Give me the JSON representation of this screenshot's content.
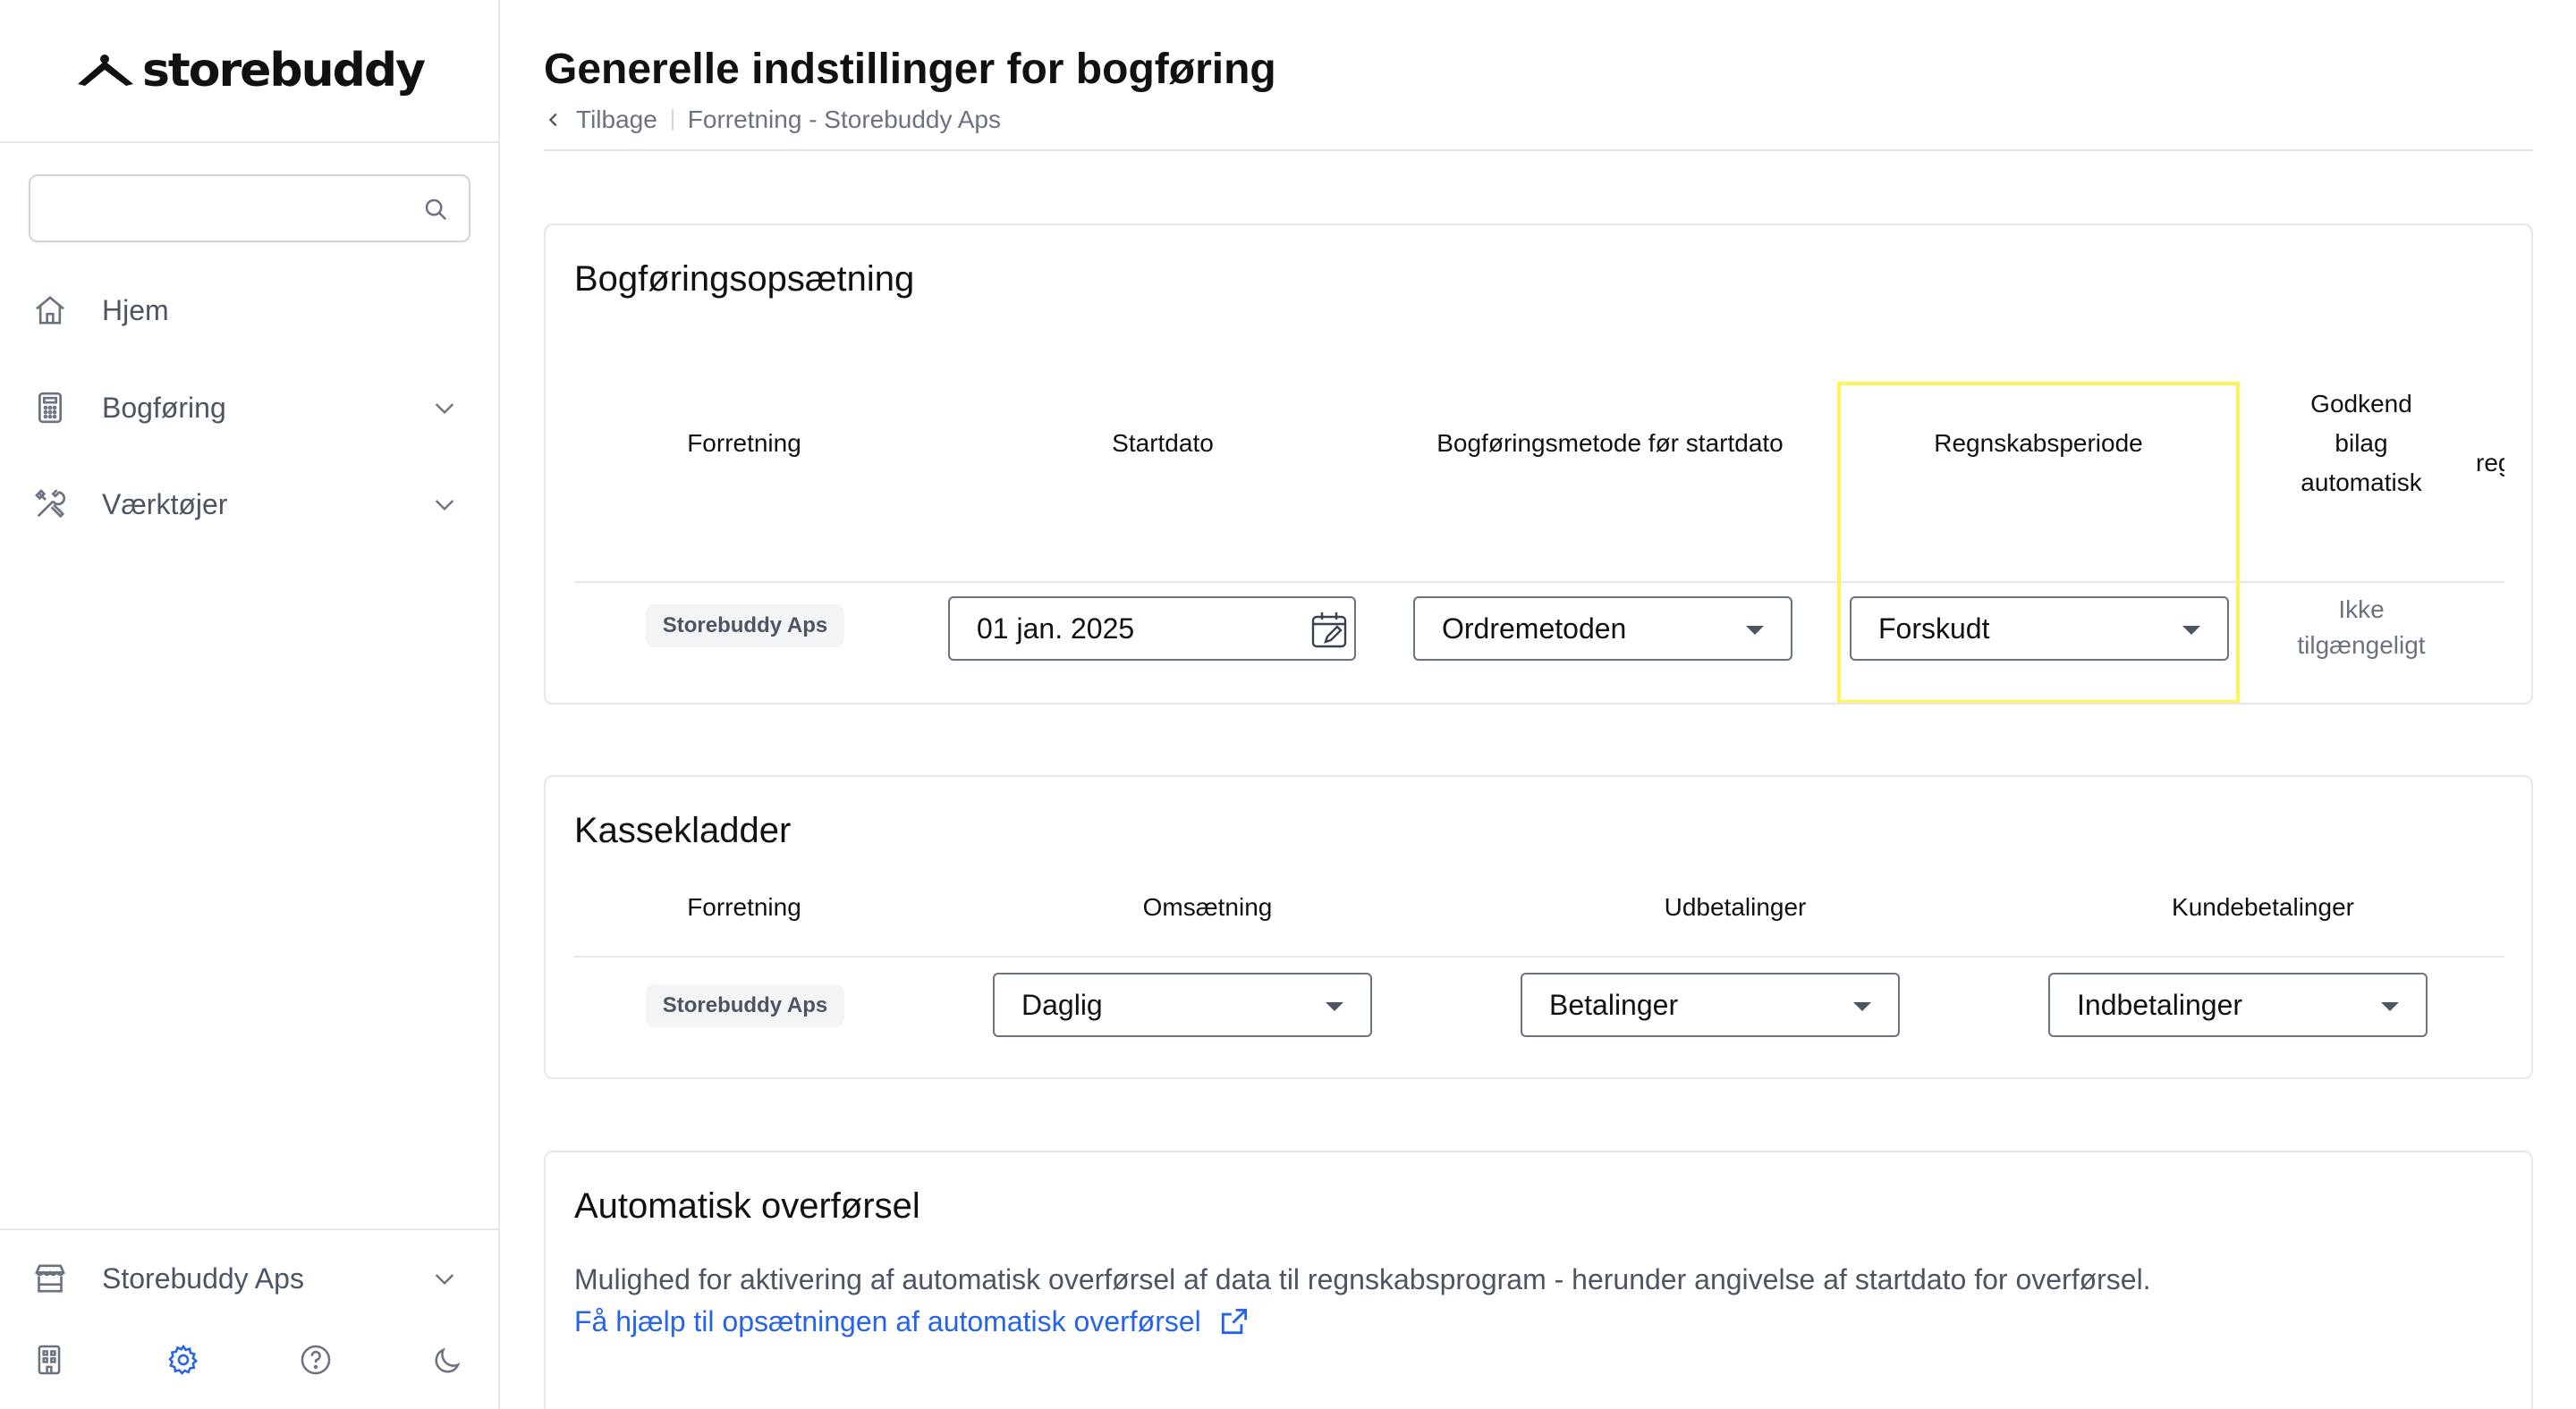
{
  "brand": {
    "logo_text": "storebuddy"
  },
  "sidebar": {
    "search": {
      "placeholder": ""
    },
    "items": [
      {
        "label": "Hjem",
        "icon": "home-icon"
      },
      {
        "label": "Bogføring",
        "icon": "calculator-icon",
        "expandable": true
      },
      {
        "label": "Værktøjer",
        "icon": "tools-icon",
        "expandable": true
      }
    ],
    "business_switcher": {
      "label": "Storebuddy Aps",
      "icon": "store-icon"
    },
    "footer_icons": [
      "building-icon",
      "gear-icon",
      "help-icon",
      "moon-icon"
    ]
  },
  "header": {
    "title": "Generelle indstillinger for bogføring",
    "back_label": "Tilbage",
    "breadcrumb_current": "Forretning - Storebuddy Aps"
  },
  "setup_card": {
    "title": "Bogføringsopsætning",
    "headers": {
      "business": "Forretning",
      "start_date": "Startdato",
      "method": "Bogføringsmetode før startdato",
      "period": "Regnskabsperiode",
      "approve_line1": "Godkend",
      "approve_line2": "bilag",
      "approve_line3": "automatisk",
      "cut_off": "reg"
    },
    "row": {
      "business": "Storebuddy Aps",
      "start_date": "01 jan. 2025",
      "method": "Ordremetoden",
      "period": "Forskudt",
      "approve_line1": "Ikke",
      "approve_line2": "tilgængeligt"
    }
  },
  "cash_card": {
    "title": "Kassekladder",
    "headers": {
      "business": "Forretning",
      "revenue": "Omsætning",
      "payouts": "Udbetalinger",
      "customer_payments": "Kundebetalinger"
    },
    "row": {
      "business": "Storebuddy Aps",
      "revenue": "Daglig",
      "payouts": "Betalinger",
      "customer_payments": "Indbetalinger"
    }
  },
  "auto_card": {
    "title": "Automatisk overførsel",
    "description": "Mulighed for aktivering af automatisk overførsel af data til regnskabsprogram - herunder angivelse af startdato for overførsel.",
    "help_link": "Få hjælp til opsætningen af automatisk overførsel"
  },
  "colors": {
    "accent_link": "#2563eb",
    "highlight": "#fff35c",
    "border": "#e5e7eb",
    "muted_text": "#6b7280"
  }
}
